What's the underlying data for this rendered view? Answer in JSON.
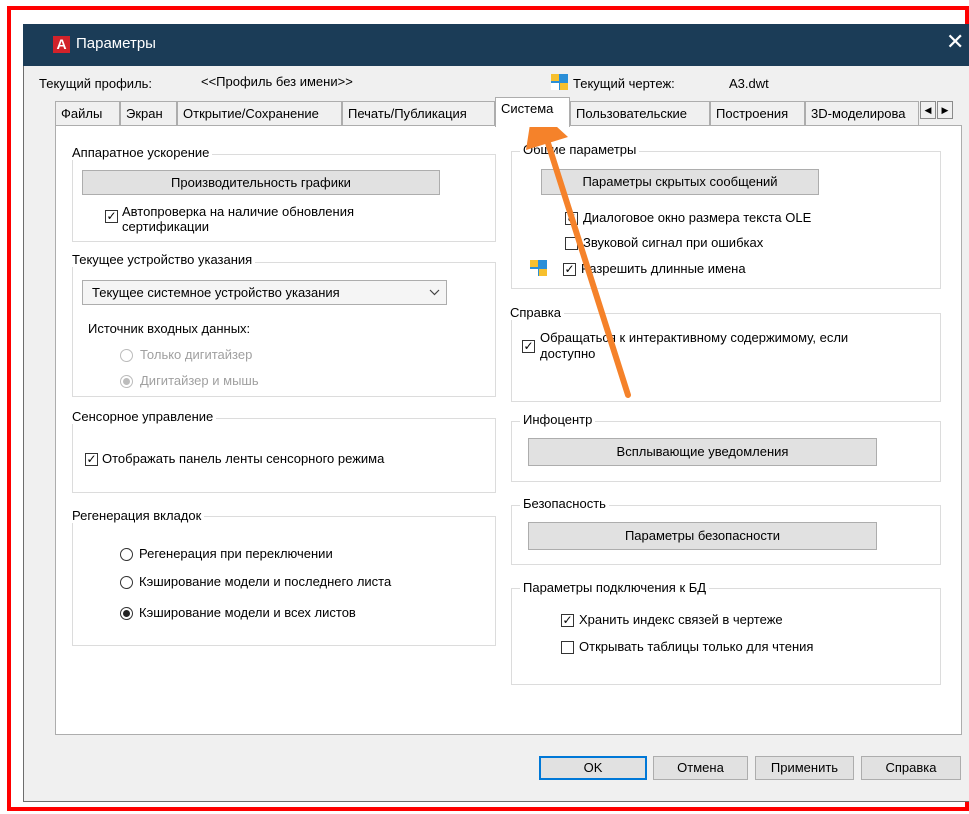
{
  "window": {
    "title": "Параметры",
    "close_glyph": "✕"
  },
  "profile": {
    "label": "Текущий профиль:",
    "value": "<<Профиль без имени>>",
    "drawing_label": "Текущий чертеж:",
    "drawing_value": "A3.dwt"
  },
  "tabs": [
    {
      "label": "Файлы",
      "active": false
    },
    {
      "label": "Экран",
      "active": false
    },
    {
      "label": "Открытие/Сохранение",
      "active": false
    },
    {
      "label": "Печать/Публикация",
      "active": false
    },
    {
      "label": "Система",
      "active": true
    },
    {
      "label": "Пользовательские",
      "active": false
    },
    {
      "label": "Построения",
      "active": false
    },
    {
      "label": "3D-моделирова",
      "active": false
    }
  ],
  "tab_scroll": {
    "left": "◀",
    "right": "▶"
  },
  "hardware": {
    "title": "Аппаратное ускорение",
    "button": "Производительность графики",
    "autocheck_line1": "Автопроверка на наличие обновления",
    "autocheck_line2": "сертификации",
    "autocheck_checked": true
  },
  "pointing": {
    "title": "Текущее устройство указания",
    "select_value": "Текущее системное устройство указания",
    "input_source_label": "Источник входных данных:",
    "options": [
      {
        "label": "Только дигитайзер",
        "selected": false
      },
      {
        "label": "Дигитайзер и мышь",
        "selected": true
      }
    ]
  },
  "touch": {
    "title": "Сенсорное управление",
    "checkbox": "Отображать панель ленты сенсорного режима",
    "checked": true
  },
  "regen": {
    "title": "Регенерация вкладок",
    "options": [
      {
        "label": "Регенерация при переключении",
        "selected": false
      },
      {
        "label": "Кэширование модели и последнего листа",
        "selected": false
      },
      {
        "label": "Кэширование модели и всех листов",
        "selected": true
      }
    ]
  },
  "general": {
    "title": "Общие параметры",
    "button": "Параметры скрытых сообщений",
    "checks": [
      {
        "label": "Диалоговое окно размера текста OLE",
        "checked": true
      },
      {
        "label": "Звуковой сигнал при ошибках",
        "checked": false
      },
      {
        "label": "Разрешить длинные имена",
        "checked": true
      }
    ]
  },
  "help": {
    "title": "Справка",
    "line1": "Обращаться к интерактивному содержимому, если",
    "line2": "доступно",
    "checked": true
  },
  "infocenter": {
    "title": "Инфоцентр",
    "button": "Всплывающие уведомления"
  },
  "security": {
    "title": "Безопасность",
    "button": "Параметры безопасности"
  },
  "db": {
    "title": "Параметры подключения к БД",
    "checks": [
      {
        "label": "Хранить индекс связей в чертеже",
        "checked": true
      },
      {
        "label": "Открывать таблицы только для чтения",
        "checked": false
      }
    ]
  },
  "footer": {
    "ok": "OK",
    "cancel": "Отмена",
    "apply": "Применить",
    "help": "Справка"
  },
  "colors": {
    "frame": "#ff0000",
    "titlebar": "#1b3c57",
    "arrow": "#f5822a",
    "ok_border": "#0078d7"
  },
  "check_glyph": "✓"
}
